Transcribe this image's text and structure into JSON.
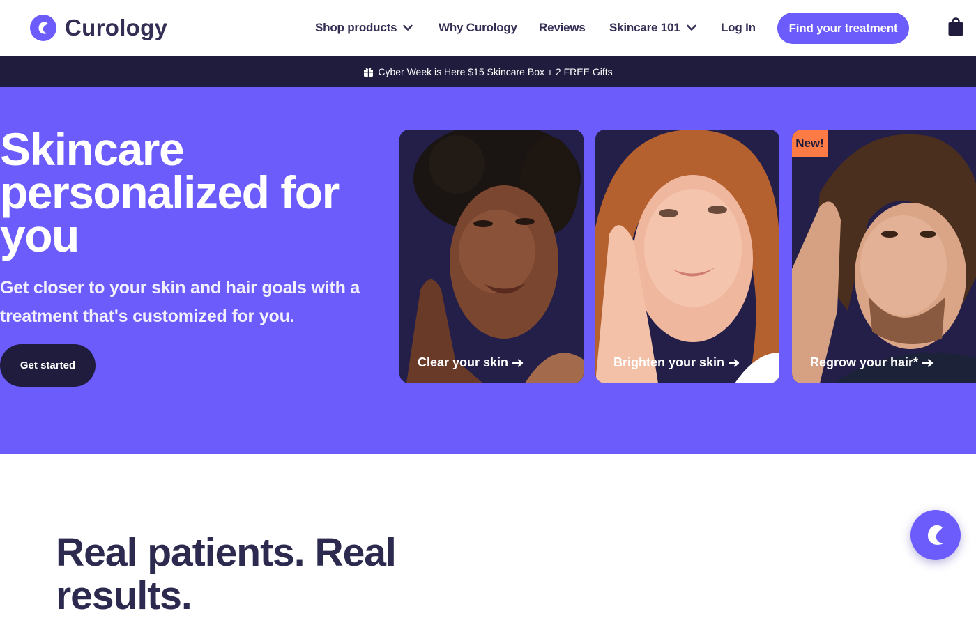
{
  "header": {
    "logo_text": "Curology",
    "logo_icon": "curology-c-icon",
    "nav": {
      "shop_products": "Shop products",
      "why_curology": "Why Curology",
      "reviews": "Reviews",
      "skincare_101": "Skincare 101",
      "log_in": "Log In"
    },
    "cta_label": "Find your treatment",
    "cart_icon": "shopping-bag-icon"
  },
  "promo": {
    "icon": "gift-icon",
    "text": "Cyber Week is Here $15 Skincare Box + 2 FREE Gifts"
  },
  "hero": {
    "title": "Skincare personalized for you",
    "subtitle": "Get closer to your skin and hair goals with a treatment that's customized for you.",
    "button_label": "Get started",
    "cards": [
      {
        "label": "Clear your skin"
      },
      {
        "label": "Brighten your skin"
      },
      {
        "label": "Regrow your hair*",
        "badge": "New!"
      }
    ]
  },
  "results": {
    "title": "Real patients. Real results."
  },
  "colors": {
    "brand_purple": "#6b5cfb",
    "navy": "#1f1c3d",
    "heading": "#332e54",
    "badge_orange": "#ff7b45"
  },
  "chat_icon": "curology-chat-icon"
}
